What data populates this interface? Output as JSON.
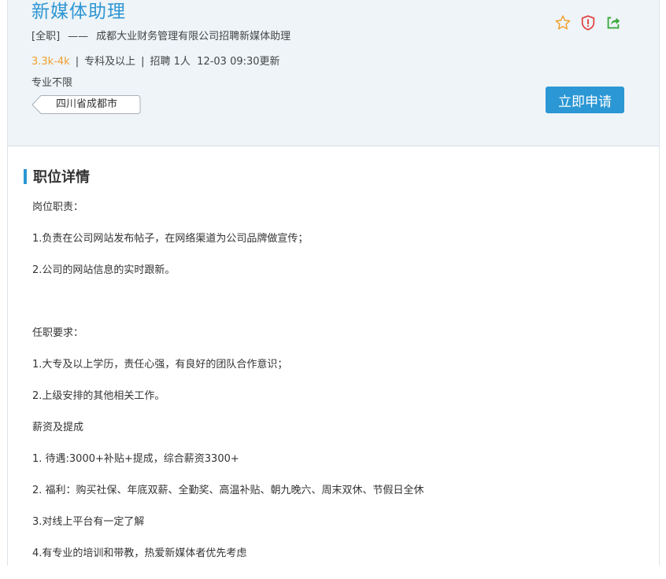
{
  "header": {
    "title": "新媒体助理",
    "type_tag": "[全职]",
    "dash": "——",
    "company_line": "成都大业财务管理有限公司招聘新媒体助理",
    "salary": "3.3k-4k",
    "sep": "|",
    "education": "专科及以上",
    "headcount": "招聘 1人",
    "updated": "12-03 09:30更新",
    "major": "专业不限",
    "location": "四川省成都市",
    "apply_label": "立即申请",
    "icons": [
      "star-icon",
      "shield-icon",
      "share-icon"
    ]
  },
  "details": {
    "section_title": "职位详情",
    "lines": [
      "岗位职责：",
      "1.负责在公司网站发布帖子，在网络渠道为公司品牌做宣传；",
      "2.公司的网站信息的实时跟新。",
      "",
      "任职要求：",
      "1.大专及以上学历，责任心强，有良好的团队合作意识；",
      "2.上级安排的其他相关工作。",
      "薪资及提成",
      "1. 待遇:3000+补贴+提成，综合薪资3300+",
      "2. 福利：购买社保、年底双薪、全勤奖、高温补贴、朝九晚六、周末双休、节假日全休",
      "3.对线上平台有一定了解",
      "4.有专业的培训和带教，热爱新媒体者优先考虑"
    ]
  },
  "colors": {
    "accent": "#2b97d4",
    "salary": "#f0a030",
    "star": "#f0a030",
    "shield": "#e23b3b",
    "share": "#3aa83a",
    "header_bg": "#eef4f8"
  }
}
